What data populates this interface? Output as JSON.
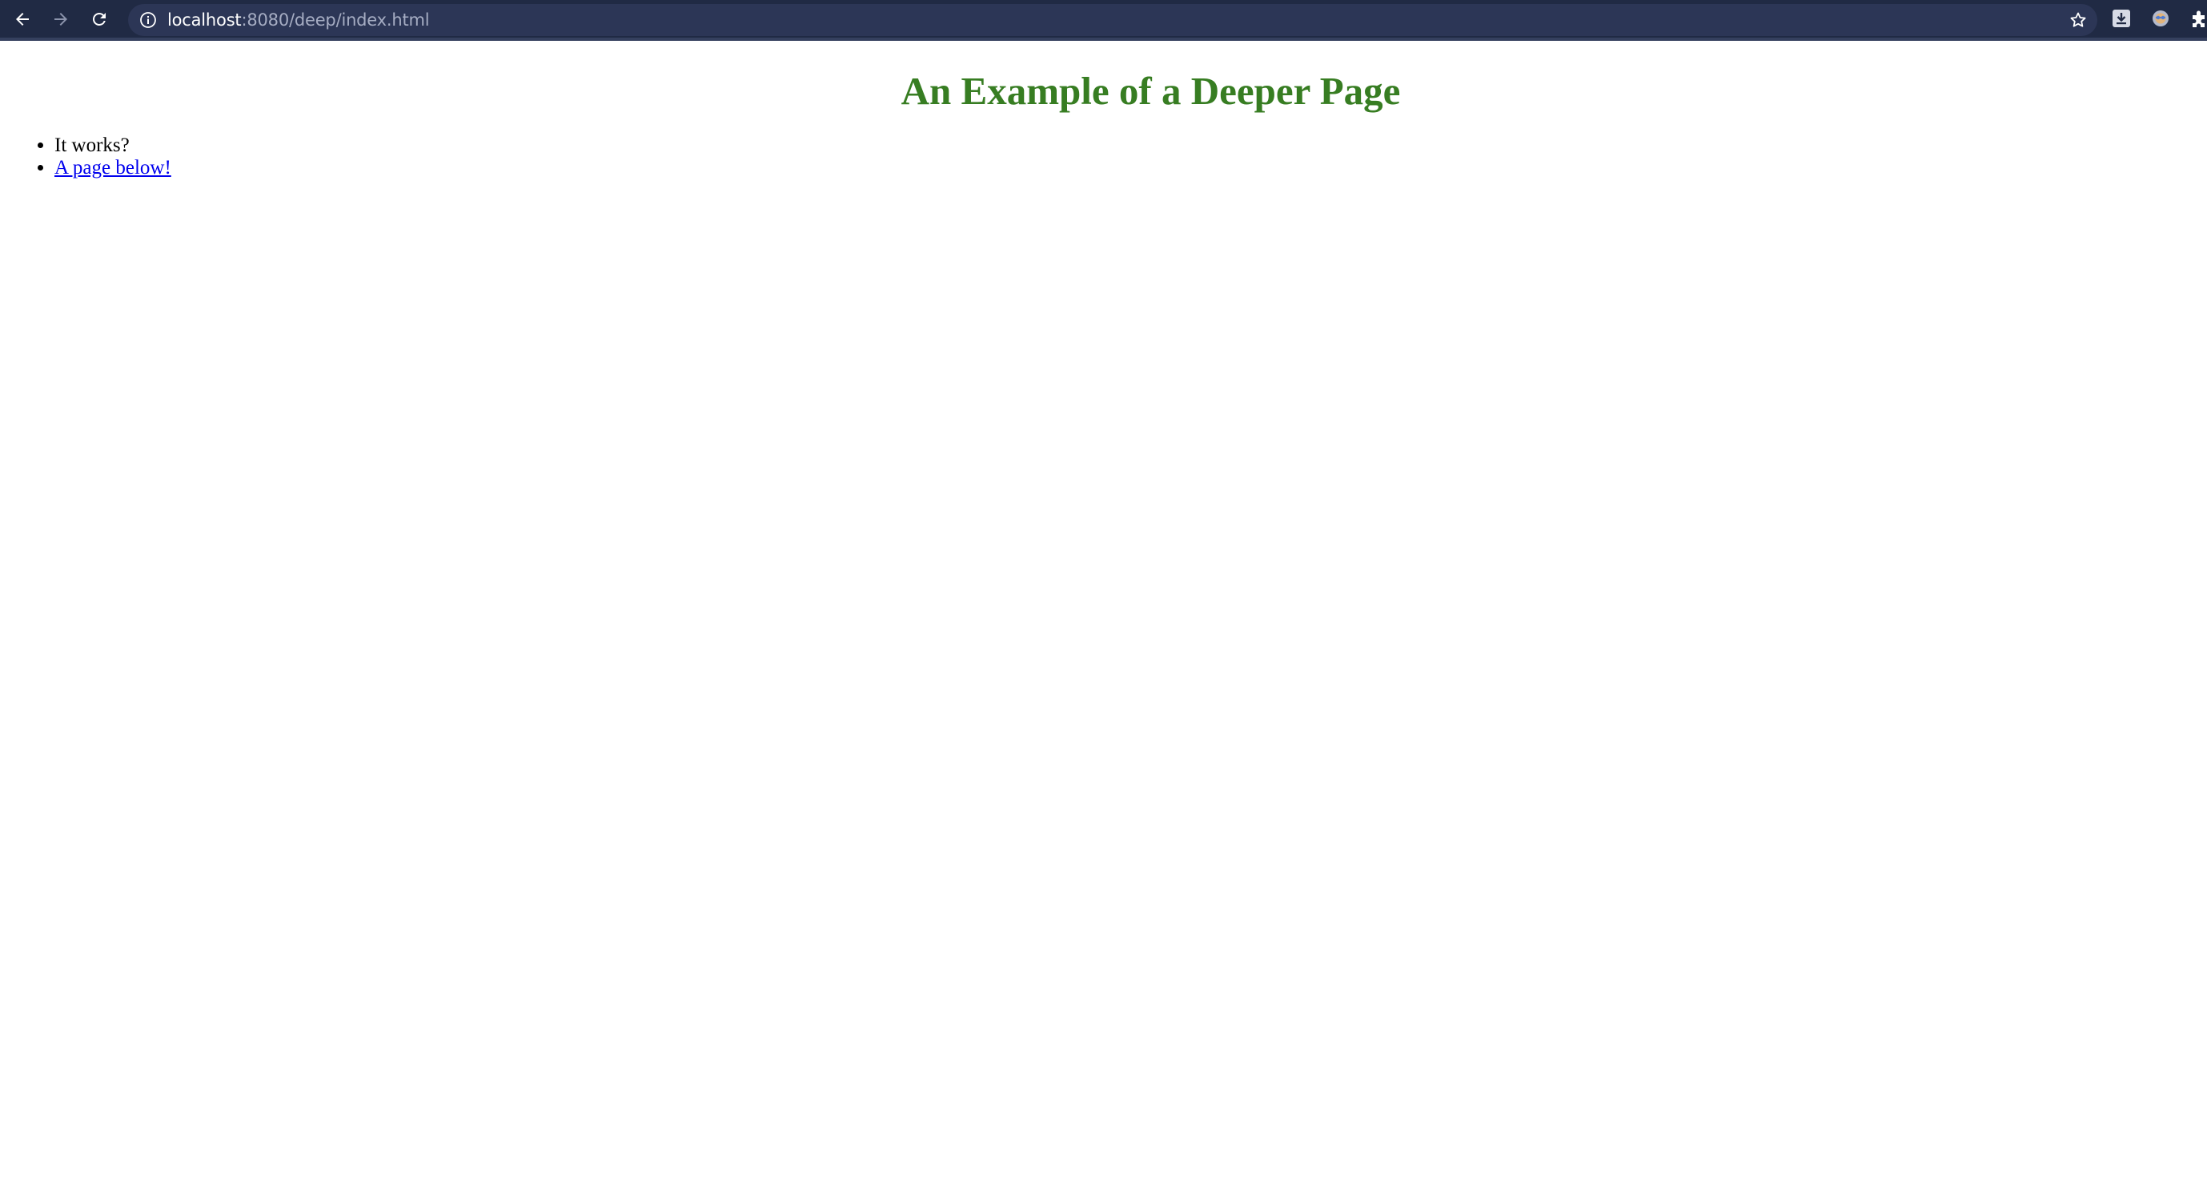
{
  "browser": {
    "url_host": "localhost",
    "url_path": ":8080/deep/index.html",
    "icons": {
      "back": "back-arrow-icon",
      "forward": "forward-arrow-icon",
      "reload": "reload-icon",
      "site_info": "info-icon",
      "bookmark": "star-icon",
      "download_ext": "download-extension-icon",
      "profile_ext": "extension-icon",
      "extensions": "puzzle-icon"
    },
    "colors": {
      "toolbar_bg": "#202a44",
      "omnibox_bg": "#2c3656",
      "url_host": "#ffffff",
      "url_path": "#a6adc3"
    }
  },
  "page": {
    "heading": "An Example of a Deeper Page",
    "heading_color": "#377d22",
    "list": [
      {
        "text": "It works?",
        "is_link": false
      },
      {
        "text": "A page below!",
        "is_link": true
      }
    ],
    "link_color": "#0000ee"
  }
}
